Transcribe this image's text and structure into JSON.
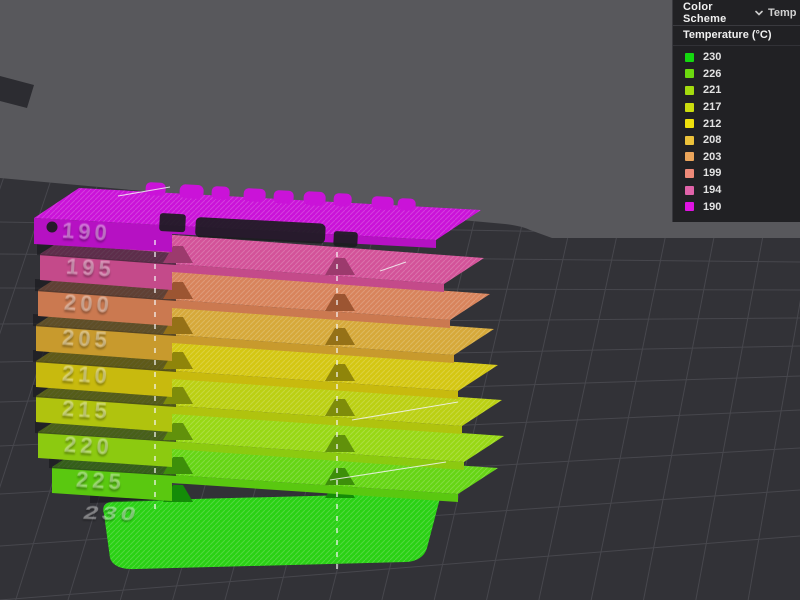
{
  "scene": {
    "viewport_color": "#58585c",
    "plate_color": "#323237",
    "grid_color": "#47474d",
    "mini_plate_color": "#2c2c31"
  },
  "legend_panel": {
    "title": "Color Scheme",
    "dropdown_value": "Temp",
    "dropdown_icon": "chevron-down-icon",
    "subtitle": "Temperature (°C)",
    "items": [
      {
        "value": "230",
        "color": "#14d80f"
      },
      {
        "value": "226",
        "color": "#6cd90f"
      },
      {
        "value": "221",
        "color": "#a4db0e"
      },
      {
        "value": "217",
        "color": "#cbdc0e"
      },
      {
        "value": "212",
        "color": "#efe00d"
      },
      {
        "value": "208",
        "color": "#edc23b"
      },
      {
        "value": "203",
        "color": "#eba55b"
      },
      {
        "value": "199",
        "color": "#ee8a79"
      },
      {
        "value": "194",
        "color": "#e063a9"
      },
      {
        "value": "190",
        "color": "#e013e2"
      }
    ]
  },
  "tower": {
    "description": "temperature tower print preview, coolest temp on top",
    "floors": [
      {
        "label": "190",
        "face_color": "#b611c3",
        "deck_color": "#ca13d8",
        "shade_color": "#8c0d99"
      },
      {
        "label": "195",
        "face_color": "#c44a8a",
        "deck_color": "#d35399",
        "shade_color": "#9c3a6d"
      },
      {
        "label": "200",
        "face_color": "#cb7950",
        "deck_color": "#d8845c",
        "shade_color": "#9c5532"
      },
      {
        "label": "205",
        "face_color": "#c89a2d",
        "deck_color": "#d6a93a",
        "shade_color": "#957117"
      },
      {
        "label": "210",
        "face_color": "#c8ba0e",
        "deck_color": "#d4c713",
        "shade_color": "#8f850a"
      },
      {
        "label": "215",
        "face_color": "#b0c30e",
        "deck_color": "#bbd013",
        "shade_color": "#7e8c0a"
      },
      {
        "label": "220",
        "face_color": "#8cca10",
        "deck_color": "#98d815",
        "shade_color": "#61910b"
      },
      {
        "label": "225",
        "face_color": "#5ac810",
        "deck_color": "#66d515",
        "shade_color": "#3d8f0a"
      },
      {
        "label": "230",
        "face_color": "#1fc40f",
        "deck_color": "#2ad114",
        "shade_color": "#148c08"
      }
    ]
  }
}
